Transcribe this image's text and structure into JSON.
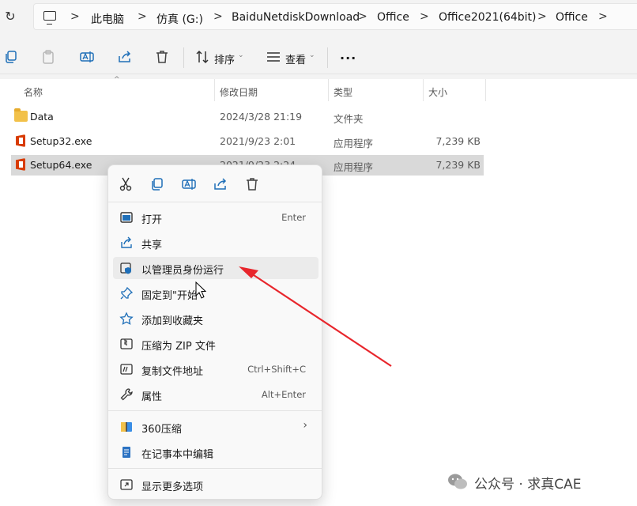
{
  "address_bar": {
    "breadcrumbs": [
      "此电脑",
      "仿真 (G:)",
      "BaiduNetdiskDownload",
      "Office",
      "Office2021(64bit)",
      "Office"
    ]
  },
  "toolbar": {
    "sort_label": "排序",
    "view_label": "查看",
    "more_label": "..."
  },
  "columns": {
    "name": "名称",
    "date": "修改日期",
    "type": "类型",
    "size": "大小"
  },
  "files": [
    {
      "name": "Data",
      "date": "2024/3/28 21:19",
      "type": "文件夹",
      "size": "",
      "icon": "folder-icon"
    },
    {
      "name": "Setup32.exe",
      "date": "2021/9/23 2:01",
      "type": "应用程序",
      "size": "7,239 KB",
      "icon": "office-icon"
    },
    {
      "name": "Setup64.exe",
      "date": "2021/9/23 2:24",
      "type": "应用程序",
      "size": "7,239 KB",
      "icon": "office-icon"
    }
  ],
  "context_menu": {
    "items": [
      {
        "label": "打开",
        "accelerator": "Enter"
      },
      {
        "label": "共享",
        "accelerator": ""
      },
      {
        "label": "以管理员身份运行",
        "accelerator": ""
      },
      {
        "label": "固定到\"开始\"",
        "accelerator": ""
      },
      {
        "label": "添加到收藏夹",
        "accelerator": ""
      },
      {
        "label": "压缩为 ZIP 文件",
        "accelerator": ""
      },
      {
        "label": "复制文件地址",
        "accelerator": "Ctrl+Shift+C"
      },
      {
        "label": "属性",
        "accelerator": "Alt+Enter"
      },
      {
        "label": "360压缩",
        "accelerator": ""
      },
      {
        "label": "在记事本中编辑",
        "accelerator": ""
      },
      {
        "label": "显示更多选项",
        "accelerator": ""
      }
    ]
  },
  "annotation": {
    "arrow_color": "#e8262c"
  },
  "watermark": {
    "text": "公众号 · 求真CAE"
  }
}
